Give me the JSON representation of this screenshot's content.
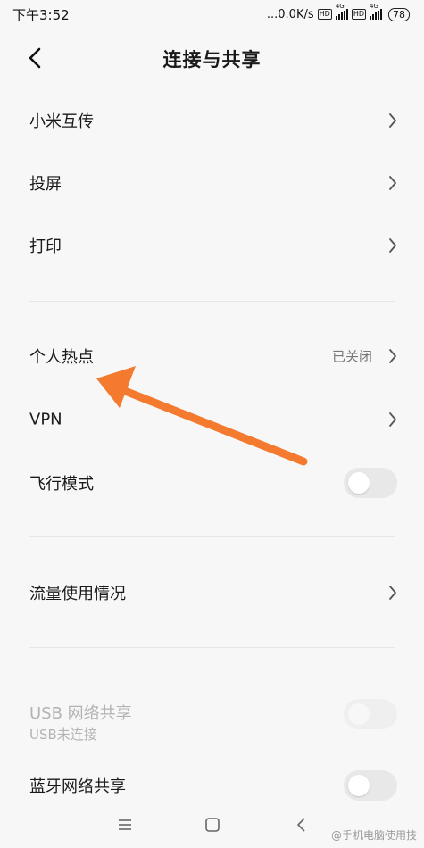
{
  "status_bar": {
    "time": "下午3:52",
    "net_speed": "...0.0K/s",
    "hd1": "HD",
    "hd2": "HD",
    "sig1_gen": "4G",
    "sig2_gen": "4G",
    "battery": "78"
  },
  "header": {
    "title": "连接与共享"
  },
  "rows": {
    "mi_share": {
      "label": "小米互传"
    },
    "cast": {
      "label": "投屏"
    },
    "print": {
      "label": "打印"
    },
    "hotspot": {
      "label": "个人热点",
      "status": "已关闭"
    },
    "vpn": {
      "label": "VPN"
    },
    "airplane": {
      "label": "飞行模式",
      "enabled": false
    },
    "data_usage": {
      "label": "流量使用情况"
    },
    "usb_tether": {
      "label": "USB 网络共享",
      "sub": "USB未连接",
      "enabled": false
    },
    "bt_tether": {
      "label": "蓝牙网络共享",
      "enabled": false
    }
  },
  "annotation": {
    "arrow_color": "#f47a2f"
  },
  "watermark": {
    "text": "@手机电脑使用技"
  },
  "colors": {
    "background": "#f7f7f7",
    "toggle_off": "#e8e8e8",
    "secondary_text": "#777777",
    "disabled_text": "#b3b3b3"
  }
}
